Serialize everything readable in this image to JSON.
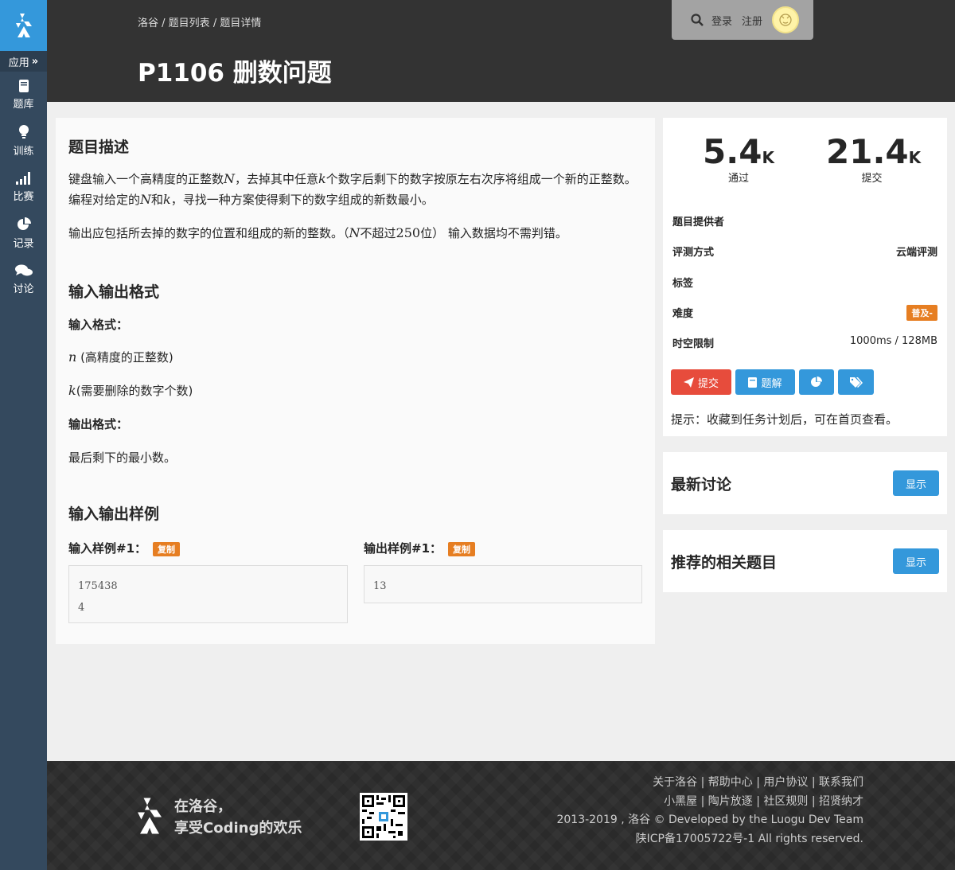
{
  "sidebar": {
    "apps_label": "应用",
    "items": [
      {
        "label": "题库",
        "icon": "book-icon"
      },
      {
        "label": "训练",
        "icon": "lightbulb-icon"
      },
      {
        "label": "比赛",
        "icon": "signal-icon"
      },
      {
        "label": "记录",
        "icon": "pie-chart-icon"
      },
      {
        "label": "讨论",
        "icon": "comments-icon"
      }
    ]
  },
  "header": {
    "breadcrumb": [
      "洛谷",
      "题目列表",
      "题目详情"
    ],
    "breadcrumb_sep": " / ",
    "title": "P1106 删数问题",
    "login": "登录",
    "register": "注册"
  },
  "problem": {
    "desc_heading": "题目描述",
    "desc_p1": {
      "a": "键盘输入一个高精度的正整数",
      "v1": "N",
      "b": "，去掉其中任意",
      "v2": "k",
      "c": "个数字后剩下的数字按原左右次序将组成一个新的正整数。编程对给定的",
      "v3": "N",
      "d": "和",
      "v4": "k",
      "e": "，寻找一种方案使得剩下的数字组成的新数最小。"
    },
    "desc_p2": {
      "a": "输出应包括所去掉的数字的位置和组成的新的整数。（",
      "v1": "N",
      "b": "不超过",
      "v2": "250",
      "c": "位） 输入数据均不需判错。"
    },
    "io_heading": "输入输出格式",
    "input_format_label": "输入格式：",
    "input_line1_var": "n",
    "input_line1_text": " (高精度的正整数)",
    "input_line2_var": "k",
    "input_line2_text": "(需要删除的数字个数)",
    "output_format_label": "输出格式：",
    "output_text": "最后剩下的最小数。",
    "sample_heading": "输入输出样例",
    "sample_in_label": "输入样例#1：",
    "sample_out_label": "输出样例#1：",
    "copy_label": "复制",
    "sample_in_lines": [
      "175438",
      "4"
    ],
    "sample_out_lines": [
      "13"
    ]
  },
  "stats": {
    "passed_num": "5.4",
    "passed_unit": "K",
    "passed_label": "通过",
    "submit_num": "21.4",
    "submit_unit": "K",
    "submit_label": "提交",
    "provider_label": "题目提供者",
    "judge_label": "评测方式",
    "judge_value": "云端评测",
    "tags_label": "标签",
    "difficulty_label": "难度",
    "difficulty_value": "普及-",
    "limit_label": "时空限制",
    "limit_value": "1000ms / 128MB",
    "submit_btn": "提交",
    "solution_btn": "题解",
    "hint": "提示：收藏到任务计划后，可在首页查看。"
  },
  "discussion": {
    "heading": "最新讨论",
    "show": "显示"
  },
  "related": {
    "heading": "推荐的相关题目",
    "show": "显示"
  },
  "footer": {
    "slogan1": "在洛谷，",
    "slogan2": "享受Coding的欢乐",
    "links1": "关于洛谷 | 帮助中心 | 用户协议 | 联系我们",
    "links2": "小黑屋 | 陶片放逐 | 社区规则 | 招贤纳才",
    "copyright": "2013-2019 , 洛谷 © Developed by the Luogu Dev Team",
    "icp": "陕ICP备17005722号-1 All rights reserved."
  },
  "colors": {
    "brand": "#3498db",
    "sidebar": "#34495e",
    "header": "#333333",
    "red": "#e74c3c",
    "orange": "#e67e22"
  }
}
